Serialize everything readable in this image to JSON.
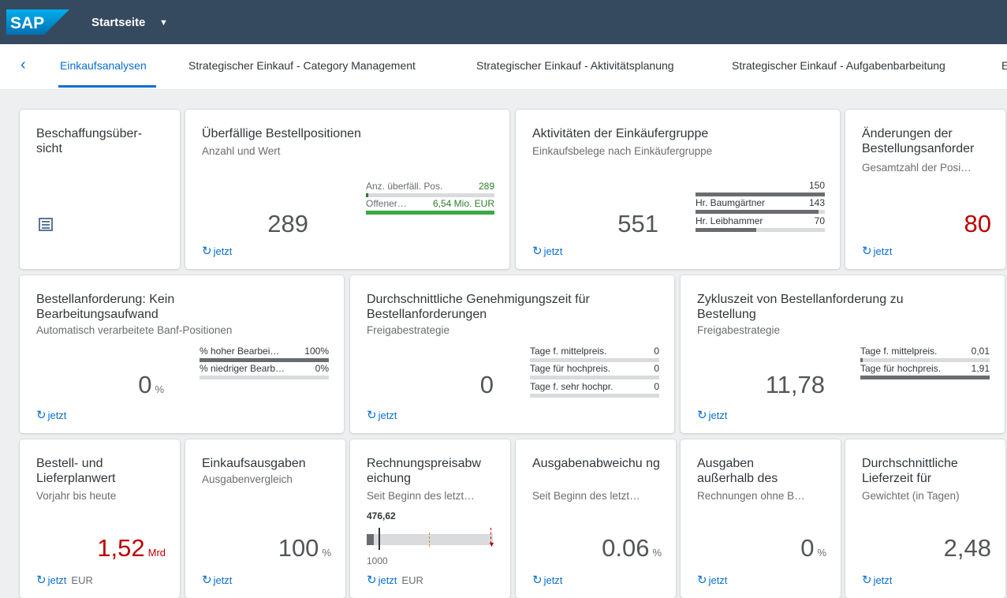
{
  "shell": {
    "logo": "SAP",
    "title": "Startseite"
  },
  "tabs": [
    {
      "label": "Einkaufsanalysen"
    },
    {
      "label": "Strategischer Einkauf - Category Management"
    },
    {
      "label": "Strategischer Einkauf - Aktivitätsplanung"
    },
    {
      "label": "Strategischer Einkauf - Aufgabenbarbeitung"
    },
    {
      "label": "E"
    }
  ],
  "common": {
    "refresh": "jetzt",
    "currency": "EUR"
  },
  "tiles": {
    "beschaffung": {
      "title": "Beschaffungsüber-\nsicht"
    },
    "ueberfaellig": {
      "title": "Überfällige Bestellpositionen",
      "sub": "Anzahl und Wert",
      "kpi": "289",
      "rows": [
        {
          "label": "Anz. überfäll. Pos.",
          "value": "289",
          "fraction": 0.02
        },
        {
          "label": "Offener…",
          "value": "6,54 Mio. EUR",
          "fraction": 1.0
        }
      ]
    },
    "aktivitaeten": {
      "title": "Aktivitäten der Einkäufergruppe",
      "sub": "Einkaufsbelege nach Einkäufergruppe",
      "kpi": "551",
      "rows": [
        {
          "label": "",
          "value": "150",
          "fraction": 1.0
        },
        {
          "label": "Hr. Baumgärtner",
          "value": "143",
          "fraction": 0.95
        },
        {
          "label": "Hr. Leibhammer",
          "value": "70",
          "fraction": 0.47
        }
      ]
    },
    "aenderungen": {
      "title": "Änderungen der Bestellungsanforder",
      "sub": "Gesamtzahl der Posi…",
      "kpi": "80"
    },
    "kein_aufwand": {
      "title": "Bestellanforderung: Kein Bearbeitungsaufwand",
      "sub": "Automatisch verarbeitete Banf-Positionen",
      "kpi": "0",
      "unit": "%",
      "rows": [
        {
          "label": "% hoher Bearbei…",
          "value": "100%",
          "fraction": 1.0
        },
        {
          "label": "% niedriger Bearb…",
          "value": "0%",
          "fraction": 0.0
        }
      ]
    },
    "genehmigung": {
      "title": "Durchschnittliche Genehmigungszeit für Bestellanforderungen",
      "sub": "Freigabestrategie",
      "kpi": "0",
      "rows": [
        {
          "label": "Tage f. mittelpreis.",
          "value": "0",
          "fraction": 0.0
        },
        {
          "label": "Tage für hochpreis.",
          "value": "0",
          "fraction": 0.0
        },
        {
          "label": "Tage f. sehr hochpr.",
          "value": "0",
          "fraction": 0.0
        }
      ]
    },
    "zykluszeit": {
      "title": "Zykluszeit von Bestellanforderung zu Bestellung",
      "sub": "Freigabestrategie",
      "kpi": "11,78",
      "rows": [
        {
          "label": "Tage f. mittelpreis.",
          "value": "0,01",
          "fraction": 0.01
        },
        {
          "label": "Tage für hochpreis.",
          "value": "1,91",
          "fraction": 1.0
        }
      ]
    },
    "bestellwert": {
      "title": "Bestell- und Lieferplanwert",
      "sub": "Vorjahr bis heute",
      "kpi": "1,52",
      "unit": "Mrd"
    },
    "ausgaben": {
      "title": "Einkaufsausgaben",
      "sub": "Ausgabenvergleich",
      "kpi": "100",
      "unit": "%"
    },
    "rechnungspreis": {
      "title": "Rechnungspreisabw eichung",
      "sub": "Seit Beginn des letzt…",
      "value": "476,62",
      "target": "1000"
    },
    "ausgabenabw": {
      "title": "Ausgabenabweichu ng",
      "sub": "Seit Beginn des letzt…",
      "kpi": "0.06",
      "unit": "%"
    },
    "ausserhalb": {
      "title": "Ausgaben außerhalb des",
      "sub": "Rechnungen ohne B…",
      "kpi": "0",
      "unit": "%"
    },
    "lieferzeit": {
      "title": "Durchschnittliche Lieferzeit für",
      "sub": "Gewichtet (in Tagen)",
      "kpi": "2,48"
    }
  },
  "colors": {
    "shell": "#354a5f",
    "accent": "#0a6ed1",
    "critical": "#bb0000",
    "good": "#2b7d2b",
    "neutral_bar": "#6a6d70"
  }
}
